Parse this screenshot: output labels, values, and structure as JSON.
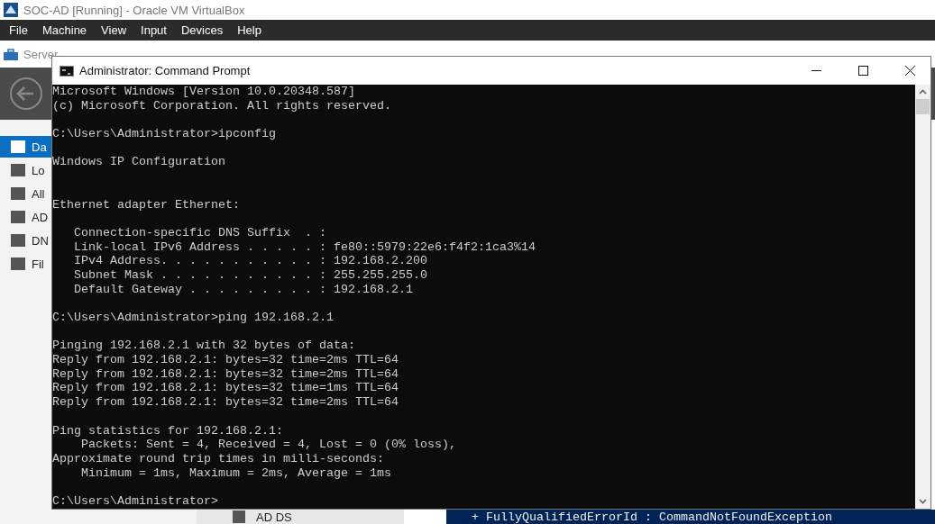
{
  "host_window": {
    "title": "SOC-AD [Running] - Oracle VM VirtualBox"
  },
  "menu_bar": [
    "File",
    "Machine",
    "View",
    "Input",
    "Devices",
    "Help"
  ],
  "server_manager": {
    "title": "Server",
    "sidebar": [
      {
        "label": "Da",
        "selected": true
      },
      {
        "label": "Lo",
        "selected": false
      },
      {
        "label": "All",
        "selected": false
      },
      {
        "label": "AD",
        "selected": false
      },
      {
        "label": "DN",
        "selected": false
      },
      {
        "label": "Fil",
        "selected": false
      }
    ],
    "bottom_item": "AD DS",
    "powershell_text": "+ FullyQualifiedErrorId : CommandNotFoundException"
  },
  "command_prompt": {
    "title": "Administrator: Command Prompt",
    "blocks": [
      {
        "kind": "first",
        "lines": [
          "Microsoft Windows [Version 10.0.20348.587]",
          "(c) Microsoft Corporation. All rights reserved."
        ]
      },
      {
        "kind": "gap",
        "lines": [
          "C:\\Users\\Administrator>ipconfig"
        ]
      },
      {
        "kind": "gap",
        "lines": [
          "Windows IP Configuration"
        ]
      },
      {
        "kind": "wide_gap",
        "lines": [
          "Ethernet adapter Ethernet:"
        ]
      },
      {
        "kind": "gap",
        "lines": [
          "   Connection-specific DNS Suffix  . :",
          "   Link-local IPv6 Address . . . . . : fe80::5979:22e6:f4f2:1ca3%14",
          "   IPv4 Address. . . . . . . . . . . : 192.168.2.200",
          "   Subnet Mask . . . . . . . . . . . : 255.255.255.0",
          "   Default Gateway . . . . . . . . . : 192.168.2.1"
        ]
      },
      {
        "kind": "gap",
        "lines": [
          "C:\\Users\\Administrator>ping 192.168.2.1"
        ]
      },
      {
        "kind": "gap",
        "lines": [
          "Pinging 192.168.2.1 with 32 bytes of data:",
          "Reply from 192.168.2.1: bytes=32 time=2ms TTL=64",
          "Reply from 192.168.2.1: bytes=32 time=2ms TTL=64",
          "Reply from 192.168.2.1: bytes=32 time=1ms TTL=64",
          "Reply from 192.168.2.1: bytes=32 time=2ms TTL=64"
        ]
      },
      {
        "kind": "gap",
        "lines": [
          "Ping statistics for 192.168.2.1:",
          "    Packets: Sent = 4, Received = 4, Lost = 0 (0% loss),",
          "Approximate round trip times in milli-seconds:",
          "    Minimum = 1ms, Maximum = 2ms, Average = 1ms"
        ]
      },
      {
        "kind": "gap",
        "lines": [
          "C:\\Users\\Administrator>"
        ]
      }
    ]
  }
}
